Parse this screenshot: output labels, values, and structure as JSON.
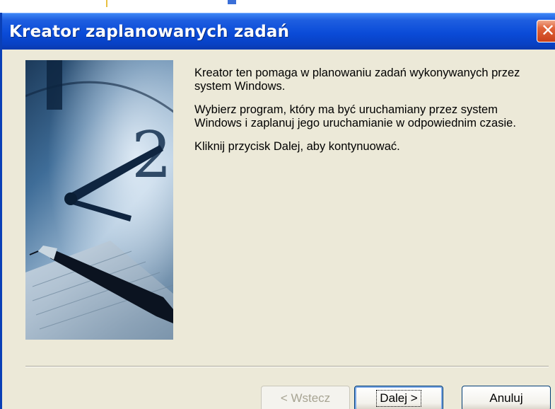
{
  "window": {
    "title": "Kreator zaplanowanych zadań",
    "close_glyph": "✕"
  },
  "content": {
    "paragraphs": [
      "Kreator ten pomaga w planowaniu zadań wykonywanych przez system Windows.",
      "Wybierz program, który ma być uruchamiany przez system Windows i zaplanuj jego uruchamianie w odpowiednim czasie.",
      "Kliknij przycisk Dalej, aby kontynuować."
    ]
  },
  "buttons": {
    "back": "< Wstecz",
    "next": "Dalej >",
    "cancel": "Anuluj"
  },
  "colors": {
    "title_bar": "#0a4bd8",
    "close_button": "#e0643a",
    "dialog_background": "#ece9d8"
  }
}
